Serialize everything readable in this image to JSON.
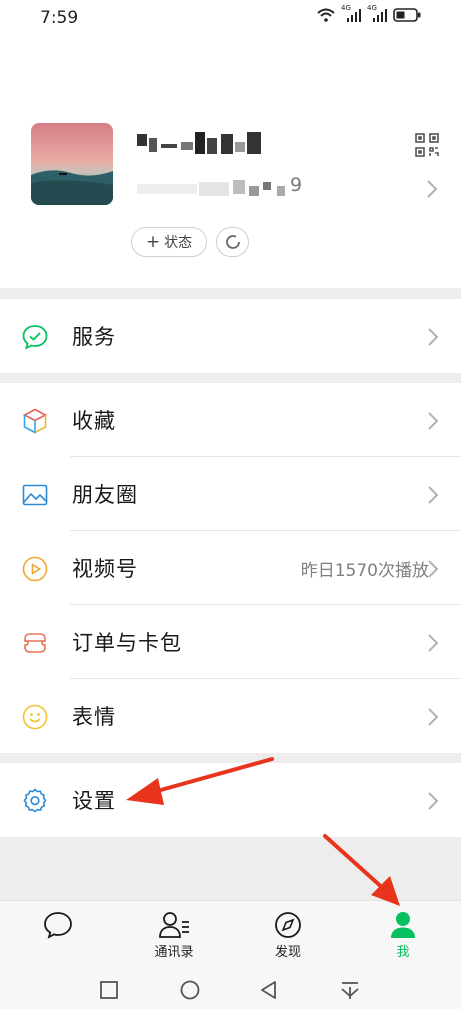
{
  "status_bar": {
    "time": "7:59",
    "network_1": "4G",
    "network_2": "4G"
  },
  "profile": {
    "wxid_suffix": "9",
    "status_button": "状态"
  },
  "menu": {
    "services": "服务",
    "favorites": "收藏",
    "moments": "朋友圈",
    "channels": "视频号",
    "channels_extra": "昨日1570次播放",
    "orders": "订单与卡包",
    "stickers": "表情",
    "settings": "设置"
  },
  "tabbar": {
    "chats": "",
    "contacts": "通讯录",
    "discover": "发现",
    "me": "我"
  },
  "colors": {
    "accent": "#07c160",
    "annotation": "#e8341c"
  }
}
